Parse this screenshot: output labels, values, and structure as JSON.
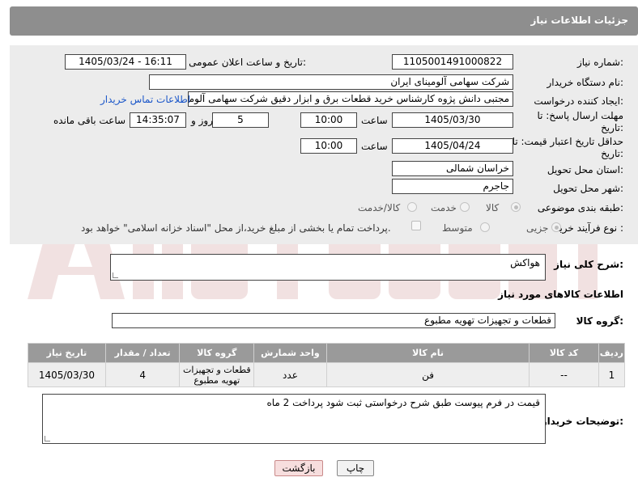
{
  "header": {
    "title": "جزئیات اطلاعات نیاز"
  },
  "fields": {
    "need_number_label": "شماره نیاز:",
    "need_number": "1105001491000822",
    "announce_label": "تاریخ و ساعت اعلان عمومی:",
    "announce_value": "1405/03/24 - 16:11",
    "buyer_org_label": "نام دستگاه خریدار:",
    "buyer_org": "شرکت سهامی آلومینای ایران",
    "creator_label": "ایجاد کننده درخواست:",
    "creator": "مجتبی دانش پژوه کارشناس خرید قطعات برق و ابزار دقیق شرکت سهامی آلومینای ایران",
    "contact_link": "اطلاعات تماس خریدار",
    "reply_deadline_label": "مهلت ارسال پاسخ: تا تاریخ:",
    "reply_date": "1405/03/30",
    "time_label": "ساعت",
    "reply_time": "10:00",
    "days_value": "5",
    "days_label": "روز و",
    "remaining_time": "14:35:07",
    "remaining_label": "ساعت باقی مانده",
    "price_deadline_label": "حداقل تاریخ اعتبار قیمت: تا تاریخ:",
    "price_date": "1405/04/24",
    "price_time": "10:00",
    "province_label": "استان محل تحویل:",
    "province": "خراسان شمالی",
    "city_label": "شهر محل تحویل:",
    "city": "جاجرم",
    "category_label": "طبقه بندی موضوعی:",
    "category_options": [
      "کالا",
      "خدمت",
      "کالا/خدمت"
    ],
    "process_label": "نوع فرآیند خرید :",
    "process_options": [
      "جزیی",
      "متوسط"
    ],
    "payment_note": "پرداخت تمام یا بخشی از مبلغ خرید،از محل \"اسناد خزانه اسلامی\" خواهد بود."
  },
  "description": {
    "label": "شرح کلی نیاز:",
    "value": "هواکش"
  },
  "goods_section": {
    "title": "اطلاعات کالاهای مورد نیاز"
  },
  "goods_group": {
    "label": "گروه کالا:",
    "value": "قطعات و تجهیزات تهویه مطبوع"
  },
  "table": {
    "headers": [
      "ردیف",
      "کد کالا",
      "نام کالا",
      "واحد شمارش",
      "گروه کالا",
      "تعداد / مقدار",
      "تاریخ نیاز"
    ],
    "rows": [
      [
        "1",
        "--",
        "فن",
        "عدد",
        "قطعات و تجهیزات تهویه مطبوع",
        "4",
        "1405/03/30"
      ]
    ]
  },
  "buyer_notes": {
    "label": "توضیحات خریدار:",
    "value": "قیمت در فرم پیوست طبق شرح درخواستی ثبت شود پرداخت 2 ماه"
  },
  "buttons": {
    "print": "چاپ",
    "back": "بازگشت"
  },
  "colors": {
    "header_bg": "#8e8e8e",
    "panel_bg": "#ececec",
    "link": "#1a56c9",
    "table_header": "#9a9a9a"
  }
}
